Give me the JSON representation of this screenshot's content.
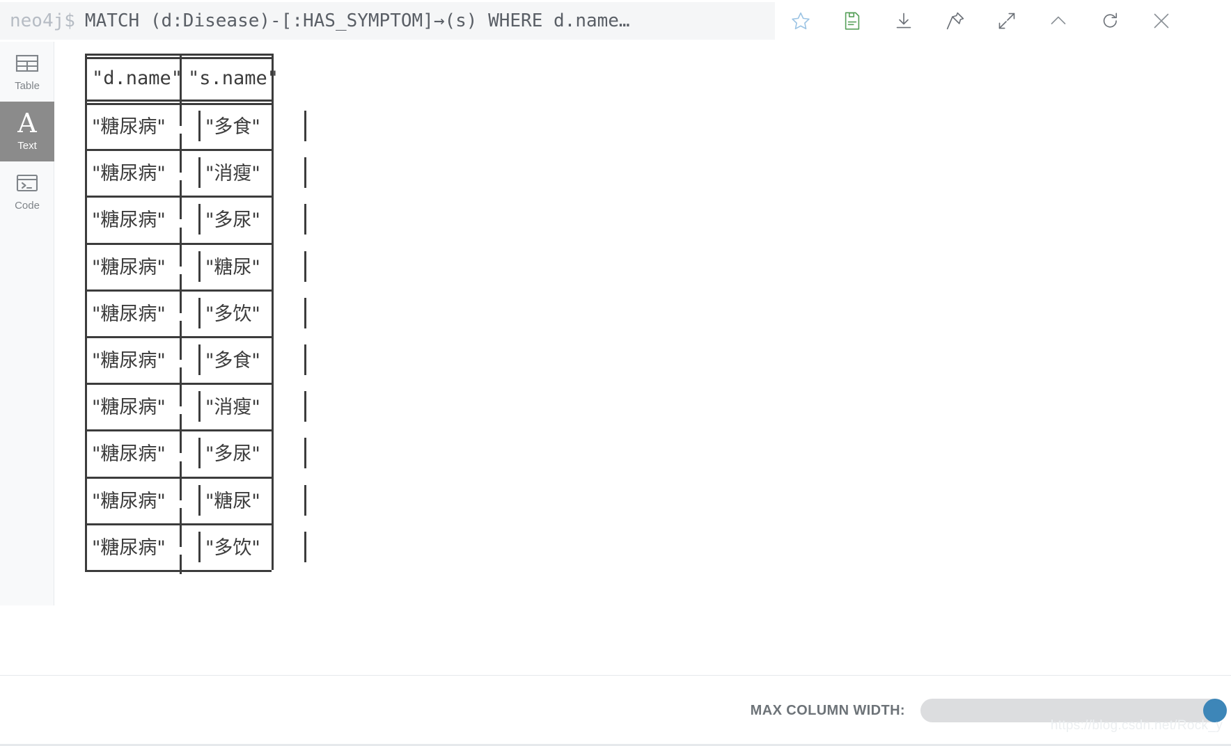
{
  "editor": {
    "prompt": "neo4j$",
    "query": "MATCH (d:Disease)-[:HAS_SYMPTOM]→(s) WHERE d.name…",
    "icons": [
      {
        "name": "favorite-star-icon",
        "label": "Favorite"
      },
      {
        "name": "save-document-icon",
        "label": "Save as project file"
      },
      {
        "name": "download-icon",
        "label": "Download"
      },
      {
        "name": "pin-icon",
        "label": "Pin"
      },
      {
        "name": "expand-icon",
        "label": "Fullscreen"
      },
      {
        "name": "chevron-up-icon",
        "label": "Collapse"
      },
      {
        "name": "refresh-icon",
        "label": "Rerun"
      },
      {
        "name": "close-icon",
        "label": "Close"
      }
    ]
  },
  "sidebar": {
    "items": [
      {
        "label": "Table",
        "icon": "table-icon",
        "active": false
      },
      {
        "label": "Text",
        "icon": "text-icon",
        "active": true
      },
      {
        "label": "Code",
        "icon": "code-icon",
        "active": false
      }
    ]
  },
  "result": {
    "columns": [
      "\"d.name\"",
      "\"s.name\""
    ],
    "rows": [
      [
        "\"糖尿病\"",
        "\"多食\""
      ],
      [
        "\"糖尿病\"",
        "\"消瘦\""
      ],
      [
        "\"糖尿病\"",
        "\"多尿\""
      ],
      [
        "\"糖尿病\"",
        "\"糖尿\""
      ],
      [
        "\"糖尿病\"",
        "\"多饮\""
      ],
      [
        "\"糖尿病\"",
        "\"多食\""
      ],
      [
        "\"糖尿病\"",
        "\"消瘦\""
      ],
      [
        "\"糖尿病\"",
        "\"多尿\""
      ],
      [
        "\"糖尿病\"",
        "\"糖尿\""
      ],
      [
        "\"糖尿病\"",
        "\"多饮\""
      ]
    ],
    "row_count": 10,
    "separator": "|"
  },
  "footer": {
    "max_column_width_label": "MAX COLUMN WIDTH:",
    "slider_value": 100,
    "slider_accent": "#3d86b8",
    "slider_track": "#dcdddf",
    "watermark": "https://blog.csdn.net/Rock_y"
  }
}
